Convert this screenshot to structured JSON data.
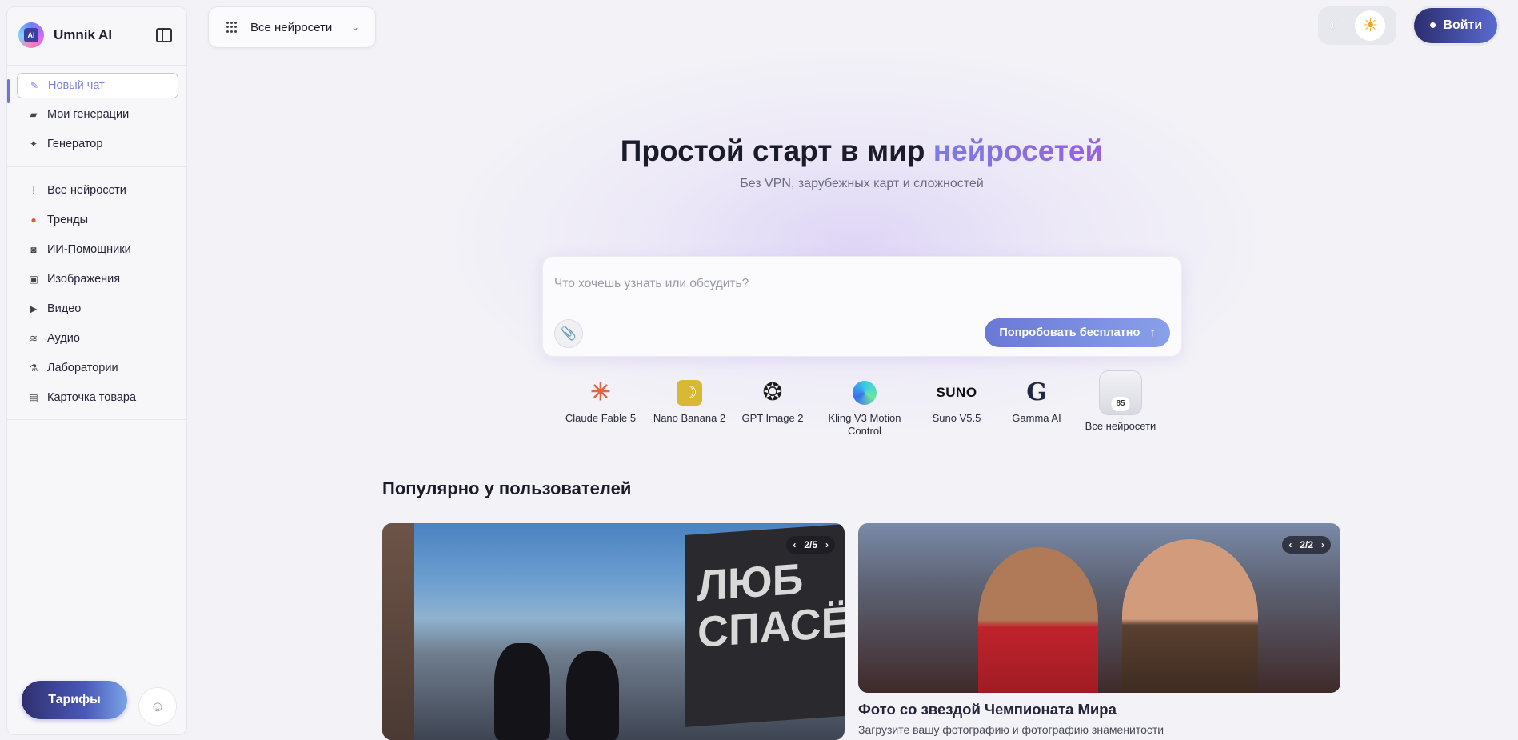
{
  "brand": {
    "name": "Umnik AI",
    "logo_text": "AI"
  },
  "sidebar": {
    "primary": [
      {
        "label": "Новый чат",
        "icon": "pencil-icon",
        "glyph": "✎"
      },
      {
        "label": "Мои генерации",
        "icon": "folder-icon",
        "glyph": "▰"
      },
      {
        "label": "Генератор",
        "icon": "sparkle-icon",
        "glyph": "✦"
      }
    ],
    "categories": [
      {
        "label": "Все нейросети",
        "icon": "grid-icon",
        "glyph": "⁞"
      },
      {
        "label": "Тренды",
        "icon": "fire-icon",
        "glyph": "●"
      },
      {
        "label": "ИИ-Помощники",
        "icon": "robot-icon",
        "glyph": "◙"
      },
      {
        "label": "Изображения",
        "icon": "image-icon",
        "glyph": "▣"
      },
      {
        "label": "Видео",
        "icon": "video-icon",
        "glyph": "▶"
      },
      {
        "label": "Аудио",
        "icon": "audio-icon",
        "glyph": "≋"
      },
      {
        "label": "Лаборатории",
        "icon": "flask-icon",
        "glyph": "⚗"
      },
      {
        "label": "Карточка товара",
        "icon": "card-icon",
        "glyph": "▤"
      }
    ],
    "tariffs_label": "Тарифы"
  },
  "topbar": {
    "model_select": "Все нейросети",
    "login_label": "Войти"
  },
  "hero": {
    "title_plain": "Простой старт в мир ",
    "title_accent": "нейросетей",
    "subtitle": "Без VPN, зарубежных карт и сложностей"
  },
  "prompt": {
    "placeholder": "Что хочешь узнать или обсудить?",
    "submit_label": "Попробовать бесплатно"
  },
  "models": [
    {
      "label": "Claude Fable 5",
      "logo": "✳"
    },
    {
      "label": "Nano Banana 2",
      "logo": "☽"
    },
    {
      "label": "GPT Image 2",
      "logo": "❂"
    },
    {
      "label": "Kling V3 Motion Control",
      "logo": ""
    },
    {
      "label": "Suno V5.5",
      "logo": "SUNO"
    },
    {
      "label": "Gamma AI",
      "logo": "G"
    },
    {
      "label": "Все нейросети",
      "count": "85"
    }
  ],
  "popular": {
    "title": "Популярно у пользователей",
    "cards": [
      {
        "pager": "2/5",
        "flag_text": "ЛЮБ СПАСЁ"
      },
      {
        "pager": "2/2",
        "title": "Фото со звездой Чемпионата Мира",
        "subtitle": "Загрузите вашу фотографию и фотографию знаменитости"
      }
    ]
  }
}
